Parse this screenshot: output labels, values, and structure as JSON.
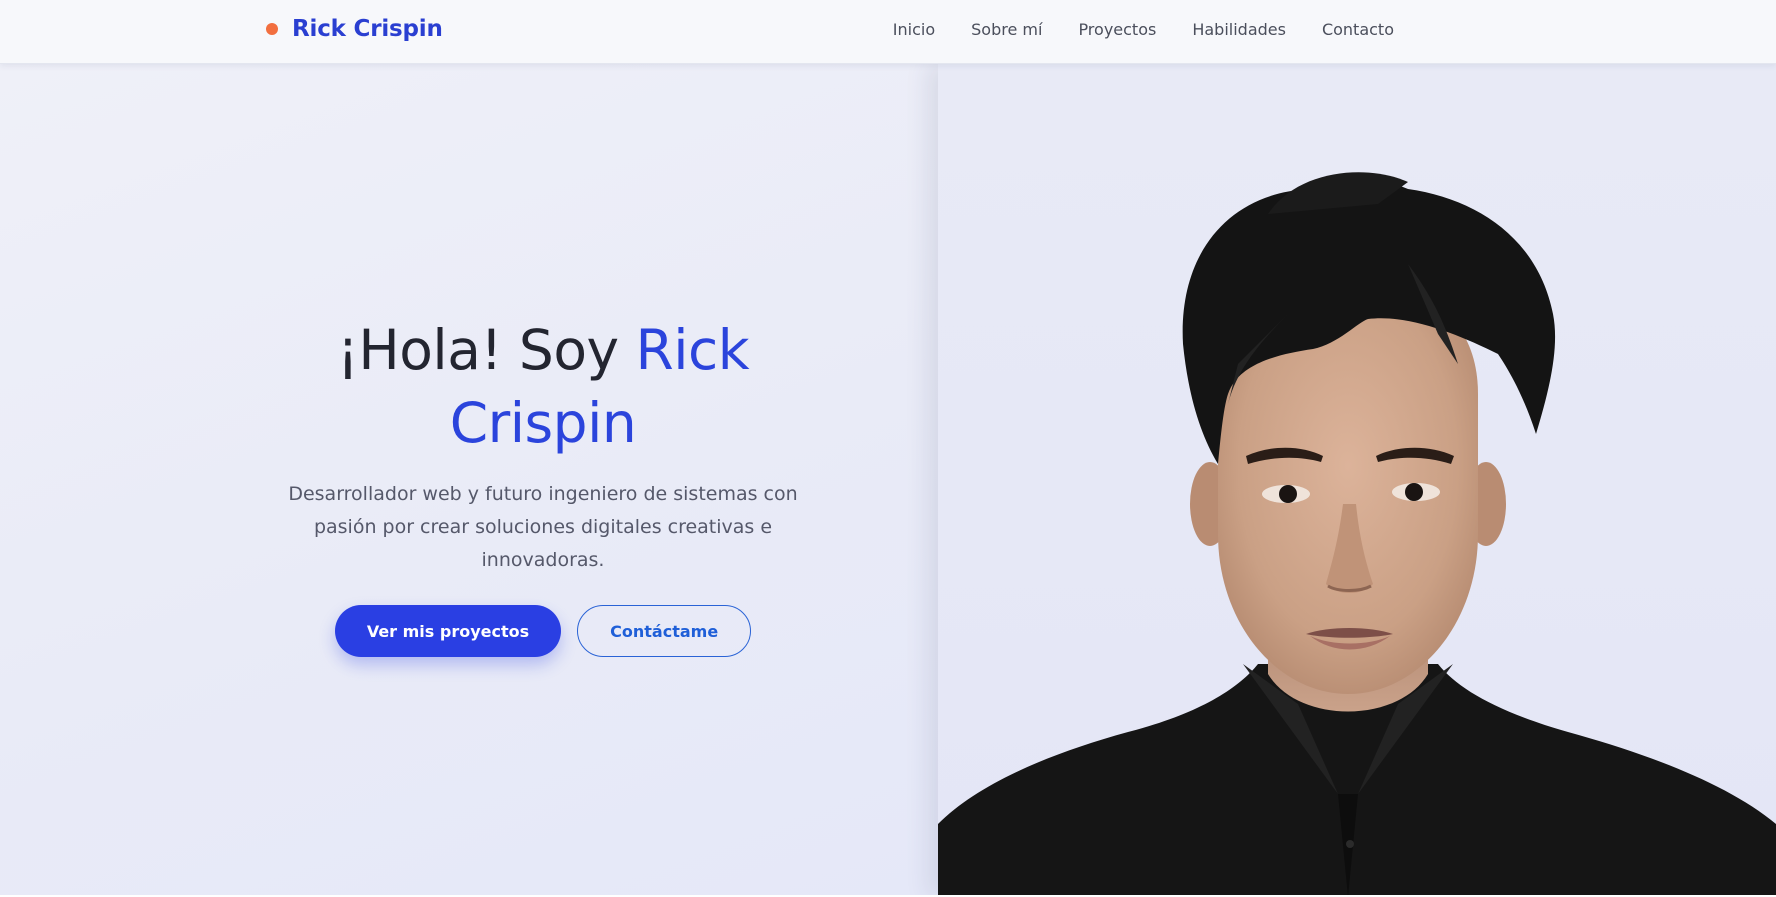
{
  "brand": {
    "name": "Rick Crispin",
    "dot_color": "#f26f3f"
  },
  "nav": {
    "items": [
      {
        "label": "Inicio"
      },
      {
        "label": "Sobre mí"
      },
      {
        "label": "Proyectos"
      },
      {
        "label": "Habilidades"
      },
      {
        "label": "Contacto"
      }
    ]
  },
  "hero": {
    "title_prefix": "¡Hola! Soy",
    "title_name": "Rick Crispin",
    "subtitle": "Desarrollador web y futuro ingeniero de sistemas con pasión por crear soluciones digitales creativas e innovadoras.",
    "primary_button": "Ver mis proyectos",
    "secondary_button": "Contáctame"
  },
  "colors": {
    "accent": "#2b44dc",
    "button_primary": "#2a3fe3",
    "button_outline": "#1f5fd8",
    "hero_bg": "#eceef8",
    "text_dark": "#232530"
  },
  "icons": {
    "brand_marker": "dot-icon"
  }
}
